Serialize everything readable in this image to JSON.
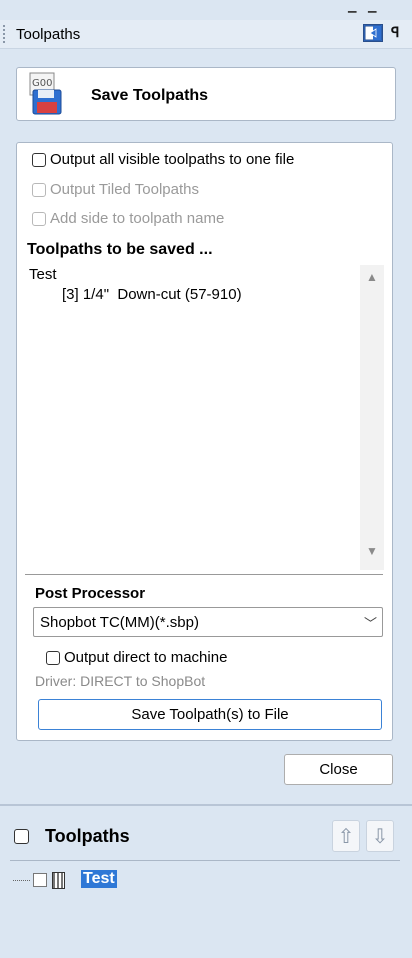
{
  "window": {
    "title": "Toolpaths"
  },
  "save_header": {
    "icon_text": "G00",
    "title": "Save Toolpaths"
  },
  "options": {
    "output_all_visible": {
      "label": "Output all visible toolpaths to one file",
      "checked": false,
      "enabled": true
    },
    "output_tiled": {
      "label": "Output Tiled Toolpaths",
      "checked": false,
      "enabled": false
    },
    "add_side_to_name": {
      "label": "Add side to toolpath name",
      "checked": false,
      "enabled": false
    }
  },
  "toolpaths_to_save": {
    "heading": "Toolpaths to be saved ...",
    "group": "Test",
    "items": [
      "[3] 1/4\"  Down-cut (57-910)"
    ]
  },
  "post_processor": {
    "heading": "Post Processor",
    "selected": "Shopbot TC(MM)(*.sbp)",
    "output_direct": {
      "label": "Output direct to machine",
      "checked": false
    },
    "driver_text": "Driver: DIRECT to ShopBot",
    "save_button": "Save Toolpath(s) to File"
  },
  "close_button": "Close",
  "toolpaths_panel": {
    "title": "Toolpaths",
    "tree": [
      {
        "label": "Test",
        "checked": false,
        "selected": true
      }
    ]
  },
  "icons": {
    "dock": "dock-panel-icon",
    "pin": "pin-icon",
    "save_file": "g00-save-file-icon",
    "scroll_up": "triangle-up-icon",
    "scroll_down": "triangle-down-icon",
    "dropdown": "chevron-down-icon",
    "move_up": "arrow-up-icon",
    "move_down": "arrow-down-icon",
    "toolpath_group": "toolpath-group-icon"
  },
  "colors": {
    "accent": "#2f78d6",
    "panel_bg": "#dbe6f2",
    "selection": "#2f78d6"
  }
}
